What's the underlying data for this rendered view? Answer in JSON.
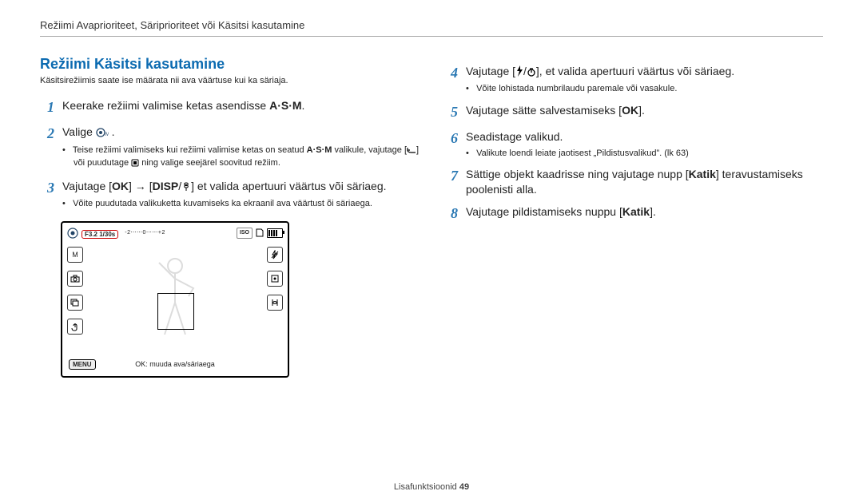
{
  "header": "Režiimi Avaprioriteet, Säriprioriteet või Käsitsi kasutamine",
  "section_title": "Režiimi Käsitsi kasutamine",
  "intro": "Käsitsirežiimis saate ise määrata nii ava väärtuse kui ka säriaja.",
  "left_steps": {
    "s1": {
      "num": "1",
      "text_a": "Keerake režiimi valimise ketas asendisse ",
      "icon": "A·S·M",
      "text_b": "."
    },
    "s2": {
      "num": "2",
      "text_a": "Valige ",
      "icon": "lens-manual-icon",
      "text_b": ".",
      "sub_a": "Teise režiimi valimiseks kui režiimi valimise ketas on seatud ",
      "sub_icon1": "A·S·M",
      "sub_b": " valikule, vajutage [",
      "sub_icon2": "back-return-icon",
      "sub_c": "] või puudutage ",
      "sub_icon3": "mode-square-icon",
      "sub_d": " ning valige seejärel soovitud režiim."
    },
    "s3": {
      "num": "3",
      "text_a": "Vajutage [",
      "ok": "OK",
      "arrow": " → ",
      "text_b": "[",
      "disp": "DISP",
      "slash": "/",
      "macro": "macro-flower-icon",
      "text_c": "] et valida apertuuri väärtus või säriaeg.",
      "sub": "Võite puudutada valikuketta kuvamiseks ka ekraanil ava väärtust õi säriaega."
    }
  },
  "right_steps": {
    "s4": {
      "num": "4",
      "text_a": "Vajutage [",
      "icon1": "flash-icon",
      "slash": "/",
      "icon2": "timer-icon",
      "text_b": "], et valida apertuuri väärtus või säriaeg.",
      "sub": "Võite lohistada numbrilaudu paremale või vasakule."
    },
    "s5": {
      "num": "5",
      "text_a": "Vajutage sätte salvestamiseks [",
      "ok": "OK",
      "text_b": "]."
    },
    "s6": {
      "num": "6",
      "text": "Seadistage valikud.",
      "sub": "Valikute loendi leiate jaotisest „Pildistusvalikud”. (lk 63)"
    },
    "s7": {
      "num": "7",
      "text_a": "Sättige objekt kaadrisse ning vajutage nupp [",
      "bold": "Katik",
      "text_b": "] teravustamiseks poolenisti alla."
    },
    "s8": {
      "num": "8",
      "text_a": "Vajutage pildistamiseks nuppu [",
      "bold": "Katik",
      "text_b": "]."
    }
  },
  "lcd": {
    "exposure": "F3.2 1/30s",
    "ev_scale": "-2⋯⋯0⋯⋯+2",
    "iso": "ISO",
    "top_right_card": "card-icon",
    "menu": "MENU",
    "bottom_text": "OK: muuda ava/säriaega",
    "left_icons": [
      "mode-m-icon",
      "camera-icon",
      "drive-icon",
      "touch-icon"
    ],
    "right_icons": [
      "flash-off-icon",
      "af-icon",
      "stabilizer-icon"
    ]
  },
  "footer": {
    "label": "Lisafunktsioonid  ",
    "page": "49"
  }
}
